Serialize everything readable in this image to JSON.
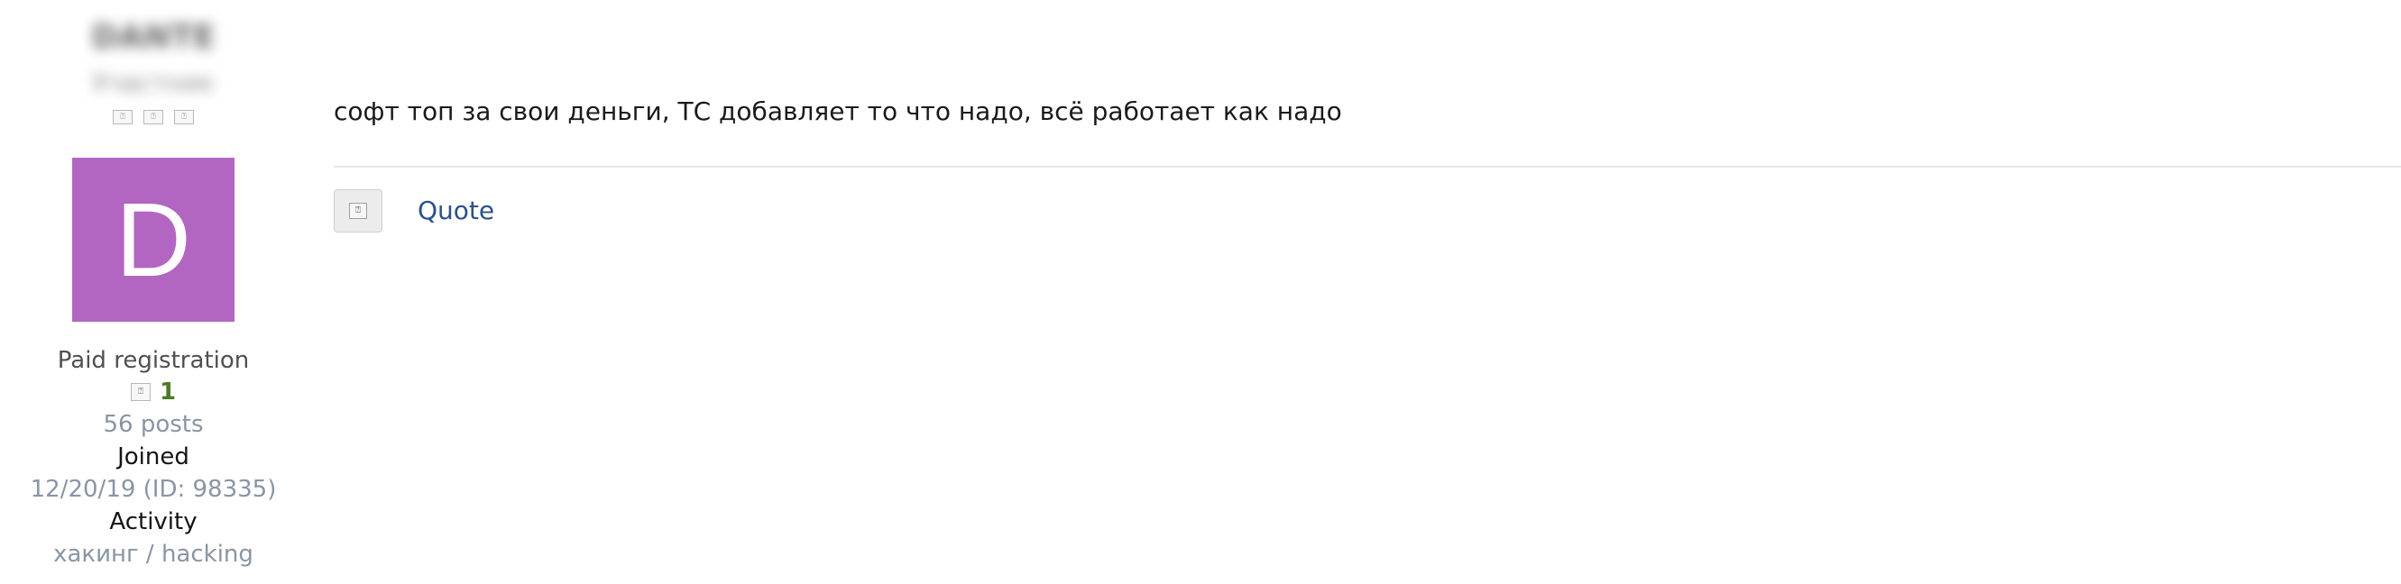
{
  "author": {
    "username": "DANTE",
    "user_title": "Участник",
    "banner_icons": [
      "banner-icon",
      "banner-icon",
      "banner-icon"
    ],
    "avatar_letter": "D",
    "avatar_color": "#b266c1",
    "user_group": "Paid registration",
    "reaction_score": "1",
    "posts": "56 posts",
    "joined_label": "Joined",
    "joined_value": "12/20/19 (ID: 98335)",
    "activity_label": "Activity",
    "activity_value": "хакинг / hacking"
  },
  "message": {
    "text": "софт топ за свои деньги, ТС добавляет то что надо, всё работает как надо"
  },
  "actions": {
    "like_icon": "like-icon",
    "quote_label": "Quote"
  },
  "colors": {
    "link": "#2b5289",
    "score": "#4f7a28",
    "muted": "#8a95a3"
  }
}
